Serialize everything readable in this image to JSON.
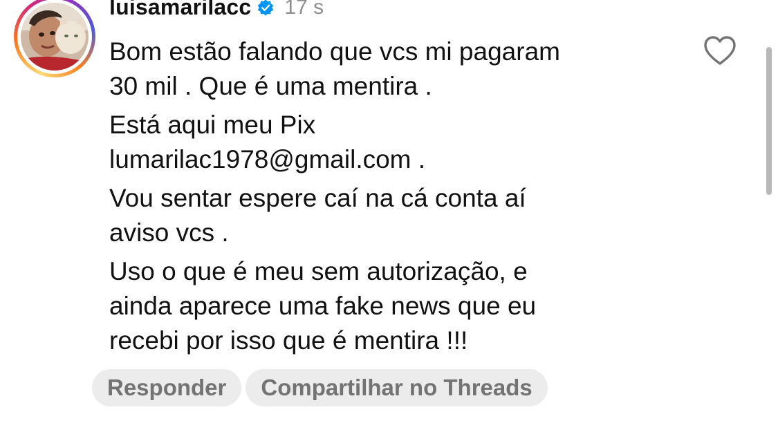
{
  "comment": {
    "username": "luisamarilacc",
    "timestamp": "17 s",
    "paragraphs": [
      {
        "lines": [
          "Bom estão falando que vcs mi pagaram",
          "30 mil . Que é uma mentira ."
        ]
      },
      {
        "lines": [
          "Está aqui meu Pix",
          "lumarilac1978@gmail.com ."
        ]
      },
      {
        "lines": [
          "Vou sentar espere caí na cá conta aí",
          "aviso vcs ."
        ]
      },
      {
        "lines": [
          "Uso o que é meu sem autorização, e",
          "ainda aparece uma fake news que eu",
          "recebi por isso que é mentira !!!"
        ]
      }
    ]
  },
  "actions": {
    "reply_label": "Responder",
    "share_label": "Compartilhar no Threads"
  },
  "icons": {
    "verified": "verified-badge-icon",
    "like": "heart-icon"
  },
  "colors": {
    "verified_blue": "#0095f6",
    "timestamp_gray": "#8e8e8e",
    "pill_background": "#ececec",
    "pill_text": "#737373"
  }
}
